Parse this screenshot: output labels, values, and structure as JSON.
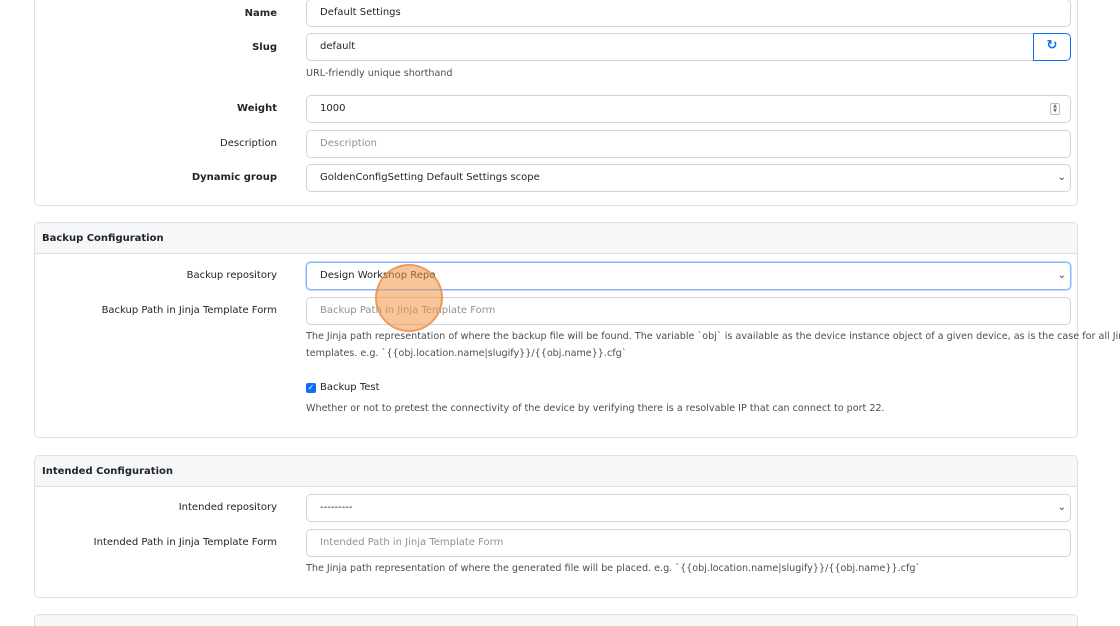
{
  "general": {
    "name_label": "Name",
    "name_value": "Default Settings",
    "slug_label": "Slug",
    "slug_value": "default",
    "slug_help": "URL-friendly unique shorthand",
    "slug_regenerate_icon": "refresh-icon",
    "weight_label": "Weight",
    "weight_value": "1000",
    "description_label": "Description",
    "description_placeholder": "Description",
    "dynamic_group_label": "Dynamic group",
    "dynamic_group_value": "GoldenConfigSetting Default Settings scope"
  },
  "backup": {
    "heading": "Backup Configuration",
    "repository_label": "Backup repository",
    "repository_value": "Design Workshop Repo",
    "path_label": "Backup Path in Jinja Template Form",
    "path_placeholder": "Backup Path in Jinja Template Form",
    "path_help_line1": "The Jinja path representation of where the backup file will be found. The variable `obj` is available as the device instance object of a given device, as is the case for all Jinja",
    "path_help_line2": "templates. e.g. `{{obj.location.name|slugify}}/{{obj.name}}.cfg`",
    "test_label": "Backup Test",
    "test_checked": true,
    "test_help": "Whether or not to pretest the connectivity of the device by verifying there is a resolvable IP that can connect to port 22."
  },
  "intended": {
    "heading": "Intended Configuration",
    "repository_label": "Intended repository",
    "repository_value": "---------",
    "path_label": "Intended Path in Jinja Template Form",
    "path_placeholder": "Intended Path in Jinja Template Form",
    "path_help": "The Jinja path representation of where the generated file will be placed. e.g. `{{obj.location.name|slugify}}/{{obj.name}}.cfg`"
  },
  "colors": {
    "accent": "#0d6efd",
    "cursor_highlight": "#f0964a"
  }
}
